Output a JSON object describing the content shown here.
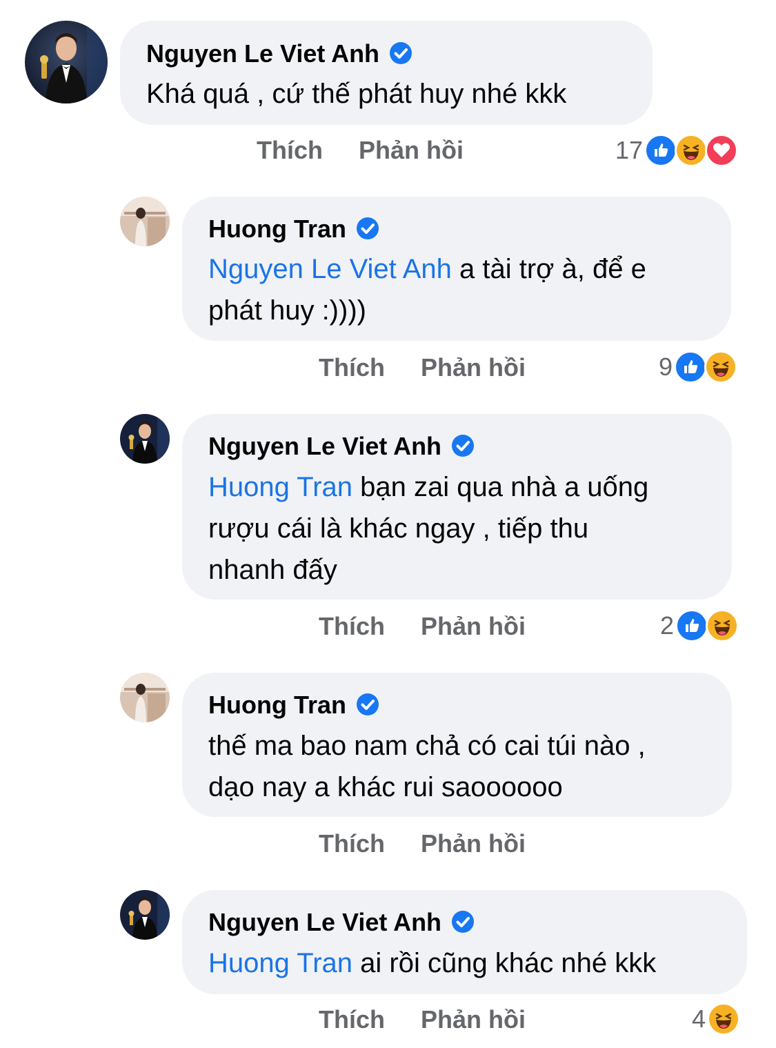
{
  "comments": [
    {
      "author": "Nguyen Le Viet Anh",
      "verified": true,
      "mention": "",
      "line1": "Khá quá , cứ thế phát huy nhé kkk",
      "line2": "",
      "line3": "",
      "like_label": "Thích",
      "reply_label": "Phản hồi",
      "reaction_count": "17",
      "reactions": [
        "like-icon",
        "haha-icon",
        "love-icon"
      ]
    },
    {
      "author": "Huong Tran",
      "verified": true,
      "mention": "Nguyen Le Viet Anh",
      "line1": " a tài trợ à, để e",
      "line2": "phát huy :))))",
      "line3": "",
      "like_label": "Thích",
      "reply_label": "Phản hồi",
      "reaction_count": "9",
      "reactions": [
        "like-icon",
        "haha-icon"
      ]
    },
    {
      "author": "Nguyen Le Viet Anh",
      "verified": true,
      "mention": "Huong Tran",
      "line1": " bạn zai qua nhà a uống",
      "line2": "rượu cái là khác ngay , tiếp thu",
      "line3": "nhanh đấy",
      "like_label": "Thích",
      "reply_label": "Phản hồi",
      "reaction_count": "2",
      "reactions": [
        "like-icon",
        "haha-icon"
      ]
    },
    {
      "author": "Huong Tran",
      "verified": true,
      "mention": "",
      "line1": "thế ma bao nam chả có cai túi nào ,",
      "line2": "dạo nay a khác rui saoooooo",
      "line3": "",
      "like_label": "Thích",
      "reply_label": "Phản hồi",
      "reaction_count": "",
      "reactions": []
    },
    {
      "author": "Nguyen Le Viet Anh",
      "verified": true,
      "mention": "Huong Tran",
      "line1": " ai rồi cũng khác nhé kkk",
      "line2": "",
      "line3": "",
      "like_label": "Thích",
      "reply_label": "Phản hồi",
      "reaction_count": "4",
      "reactions": [
        "haha-icon"
      ]
    }
  ],
  "colors": {
    "bubble": "#f0f2f5",
    "mention": "#1b74e4",
    "action_text": "#65676b",
    "like": "#1877f2",
    "haha": "#f7b125",
    "love": "#f33e58",
    "verified": "#1877f2"
  }
}
